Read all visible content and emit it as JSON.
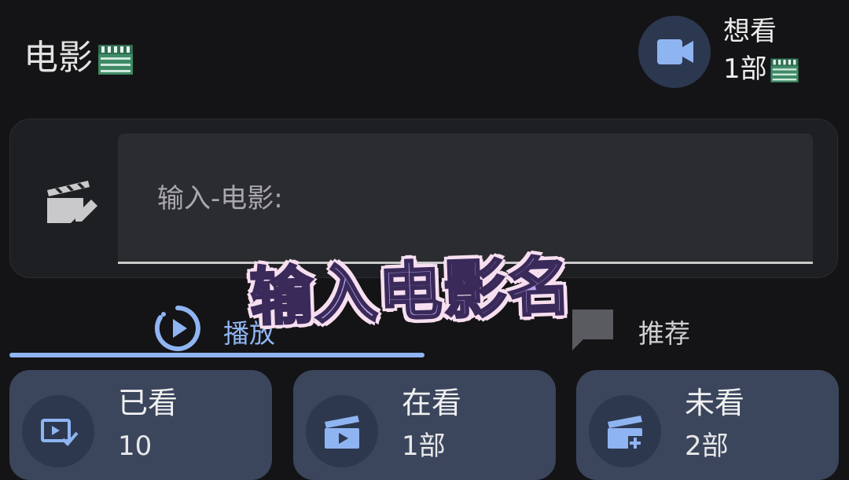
{
  "header": {
    "title": "电影",
    "title_icon": "clapperboard-emoji",
    "want": {
      "icon": "video-camera-icon",
      "label": "想看",
      "count": "1部",
      "count_icon": "clapperboard-emoji"
    }
  },
  "search": {
    "leading_icon": "movie-edit-icon",
    "placeholder": "输入-电影:",
    "value": ""
  },
  "overlay": {
    "text": "输入电影名"
  },
  "tabs": [
    {
      "label": "播放",
      "icon": "play-circle-icon",
      "active": true
    },
    {
      "label": "推荐",
      "icon": "chat-bubble-icon",
      "active": false
    }
  ],
  "stats": [
    {
      "label": "已看",
      "value": "10",
      "icon": "watched-screen-check-icon"
    },
    {
      "label": "在看",
      "value": "1部",
      "icon": "movie-play-icon"
    },
    {
      "label": "未看",
      "value": "2部",
      "icon": "movie-add-icon"
    }
  ],
  "colors": {
    "background": "#141416",
    "accent": "#8fb4f2",
    "card": "#3b465d",
    "icon_circle": "#2d384e",
    "icon_blue": "#8fb4f2",
    "overlay_fill": "#b8a4ea"
  }
}
